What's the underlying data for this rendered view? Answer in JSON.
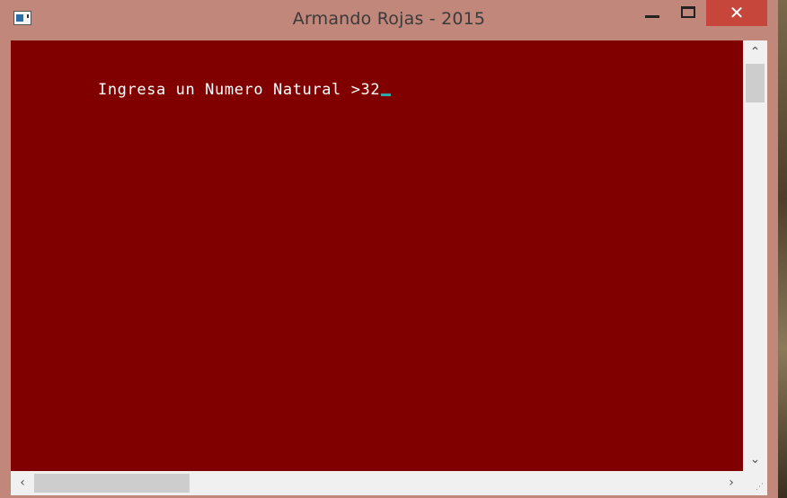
{
  "window": {
    "title": "Armando Rojas - 2015",
    "close_glyph": "✕",
    "icons": {
      "app": "console-app-icon",
      "minimize": "minimize-icon",
      "maximize": "maximize-icon",
      "close": "close-icon"
    }
  },
  "console": {
    "prompt": "Ingresa un Numero Natural >",
    "input_value": "32",
    "background_color": "#800000",
    "text_color": "#ffffff",
    "cursor_color": "#2fa7a7"
  },
  "scrollbars": {
    "vertical": {
      "up_glyph": "⌃",
      "down_glyph": "⌄"
    },
    "horizontal": {
      "left_glyph": "‹",
      "right_glyph": "›"
    },
    "grip_glyph": "⋰"
  },
  "colors": {
    "titlebar": "#c1877a",
    "close_button": "#c7463c",
    "scrollbar_track": "#f0f0f0",
    "scrollbar_thumb": "#cdcdcd"
  }
}
